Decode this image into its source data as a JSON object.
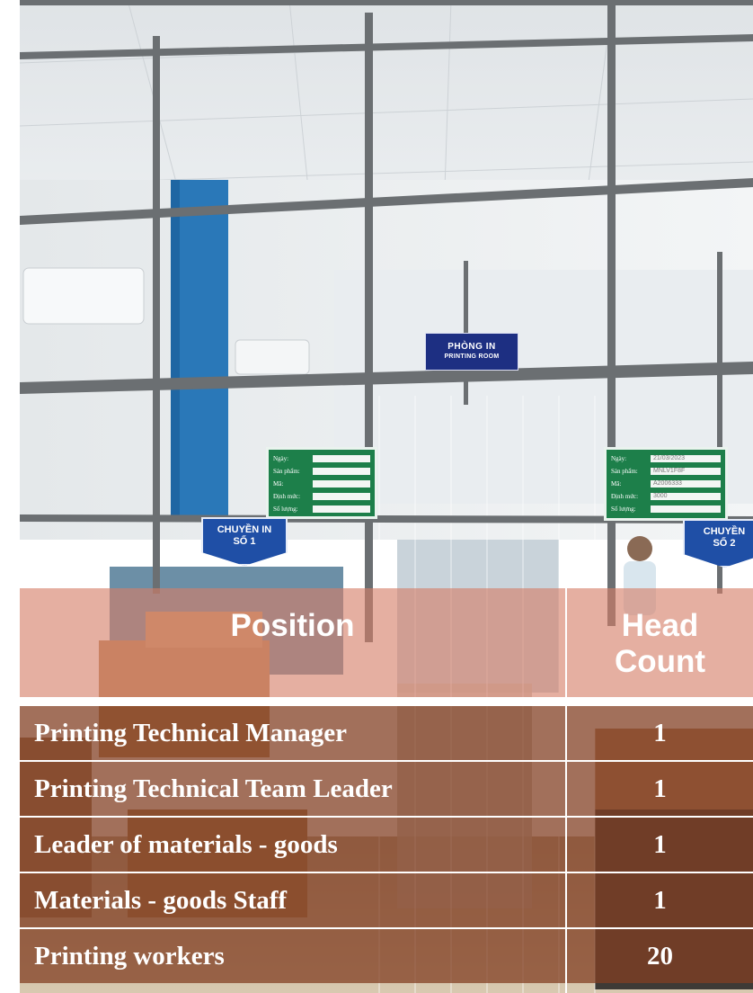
{
  "signs": {
    "room_vi": "PHÒNG IN",
    "room_en": "PRINTING ROOM",
    "line1_top": "CHUYỀN IN",
    "line1_bottom": "SỐ 1",
    "line2_top": "CHUYỀN",
    "line2_bottom": "SỐ 2"
  },
  "boards": {
    "left": {
      "rows": [
        {
          "key": "Ngày:",
          "value": ""
        },
        {
          "key": "Sản phẩm:",
          "value": ""
        },
        {
          "key": "Mã:",
          "value": ""
        },
        {
          "key": "Định mức:",
          "value": ""
        },
        {
          "key": "Số lượng:",
          "value": ""
        }
      ]
    },
    "right": {
      "rows": [
        {
          "key": "Ngày:",
          "value": "21/03/2023"
        },
        {
          "key": "Sản phẩm:",
          "value": "MNLV1F8F"
        },
        {
          "key": "Mã:",
          "value": "A2006333"
        },
        {
          "key": "Định mức:",
          "value": "3000"
        },
        {
          "key": "Số lượng:",
          "value": ""
        }
      ]
    }
  },
  "table": {
    "headers": {
      "position": "Position",
      "head_count": "Head\nCount"
    },
    "rows": [
      {
        "position": "Printing Technical Manager",
        "count": "1"
      },
      {
        "position": "Printing Technical Team Leader",
        "count": "1"
      },
      {
        "position": "Leader of materials - goods",
        "count": "1"
      },
      {
        "position": "Materials - goods Staff",
        "count": "1"
      },
      {
        "position": "Printing workers",
        "count": "20"
      }
    ]
  },
  "colors": {
    "header_fill": "#d57e68",
    "row_fill": "#823e22",
    "table_text": "#ffffff",
    "room_sign": "#1d2f82",
    "line_sign": "#1f4fa6",
    "board": "#1d7f4a"
  }
}
